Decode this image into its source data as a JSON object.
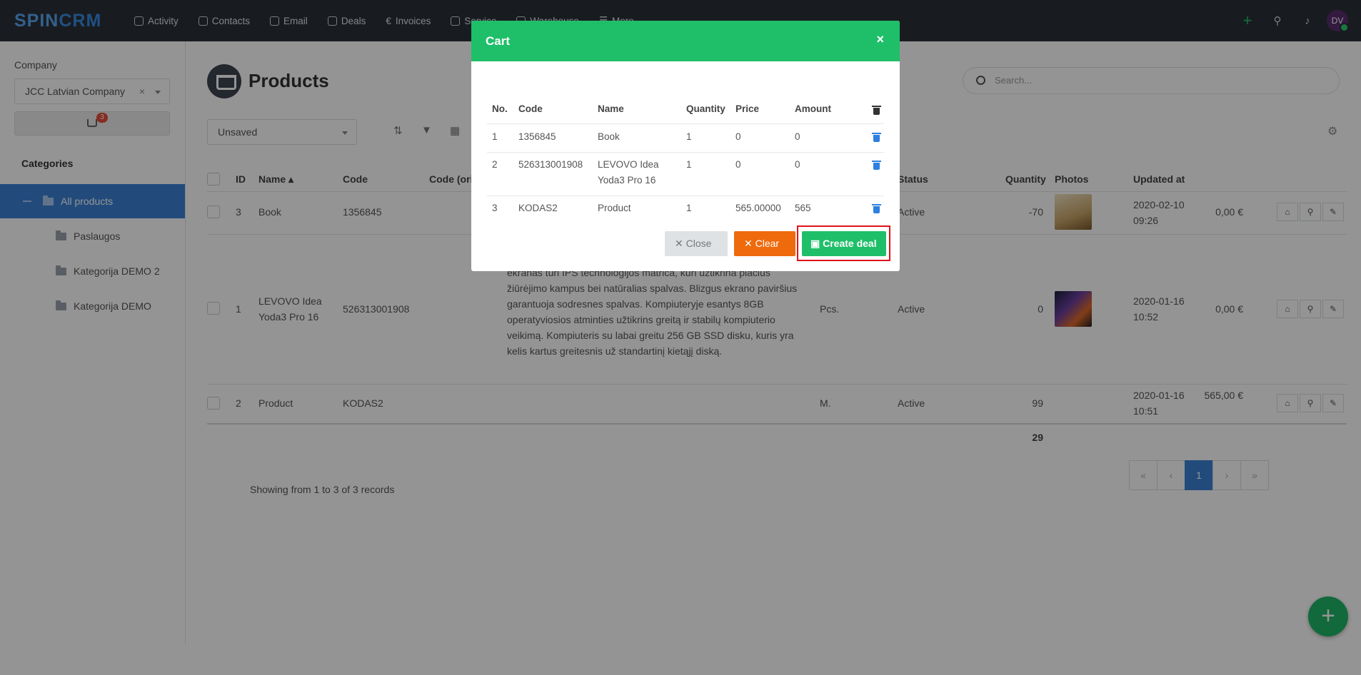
{
  "app": {
    "logo_a": "SPIN",
    "logo_b": "CRM"
  },
  "nav": [
    "Activity",
    "Contacts",
    "Email",
    "Deals",
    "Invoices",
    "Service",
    "Warehouse",
    "More"
  ],
  "user_initials": "DV",
  "sidebar": {
    "company_label": "Company",
    "company_value": "JCC Latvian Company",
    "cart_count": "3",
    "categories_title": "Categories",
    "categories": [
      "All products",
      "Paslaugos",
      "Kategorija DEMO 2",
      "Kategorija DEMO"
    ]
  },
  "page": {
    "title": "Products",
    "search_placeholder": "Search...",
    "view_select": "Unsaved",
    "columns": [
      "ID",
      "Name",
      "Code",
      "Code (original)",
      "Status",
      "Quantity",
      "Photos",
      "Updated at"
    ],
    "rows": [
      {
        "id": "3",
        "name": "Book",
        "code": "1356845",
        "unit": "",
        "status": "Active",
        "qty": "-70",
        "updated": "2020-02-10 09:26",
        "price": "0,00 €"
      },
      {
        "id": "1",
        "name": "LEVOVO Idea Yoda3 Pro 16",
        "code": "526313001908",
        "unit": "Pcs.",
        "status": "Active",
        "qty": "0",
        "updated": "2020-01-16 10:52",
        "price": "0,00 €",
        "desc": "raiškos ekranas tikrai užtikrins išskirtinę vaizdo kokybę , nes ekranas turi IPS technologijos matrica, kuri užtikrina plačius žiūrėjimo kampus bei natūralias spalvas. Blizgus ekrano paviršius garantuoja sodresnes spalvas. Kompiuteryje esantys 8GB operatyviosios atminties užtikrins greitą ir stabilų kompiuterio veikimą. Kompiuteris su labai greitu 256 GB SSD disku, kuris yra kelis kartus greitesnis už standartinį kietąjį diską."
      },
      {
        "id": "2",
        "name": "Product",
        "code": "KODAS2",
        "unit": "M.",
        "status": "Active",
        "qty": "99",
        "updated": "2020-01-16 10:51",
        "price": "565,00 €"
      }
    ],
    "total_qty": "29",
    "records_text": "Showing from 1 to 3 of 3 records",
    "pager": [
      "«",
      "‹",
      "1",
      "›",
      "»"
    ]
  },
  "cart_modal": {
    "title": "Cart",
    "columns": [
      "No.",
      "Code",
      "Name",
      "Quantity",
      "Price",
      "Amount"
    ],
    "items": [
      {
        "no": "1",
        "code": "1356845",
        "name": "Book",
        "qty": "1",
        "price": "0",
        "amount": "0"
      },
      {
        "no": "2",
        "code": "526313001908",
        "name": "LEVOVO Idea Yoda3 Pro 16",
        "qty": "1",
        "price": "0",
        "amount": "0"
      },
      {
        "no": "3",
        "code": "KODAS2",
        "name": "Product",
        "qty": "1",
        "price": "565.00000",
        "amount": "565"
      }
    ],
    "btn_close": "Close",
    "btn_clear": "Clear",
    "btn_create": "Create deal"
  },
  "colors": {
    "accent": "#3c82d6",
    "success": "#1fbf69",
    "warning": "#ef6a0c",
    "danger": "#e0121a"
  }
}
